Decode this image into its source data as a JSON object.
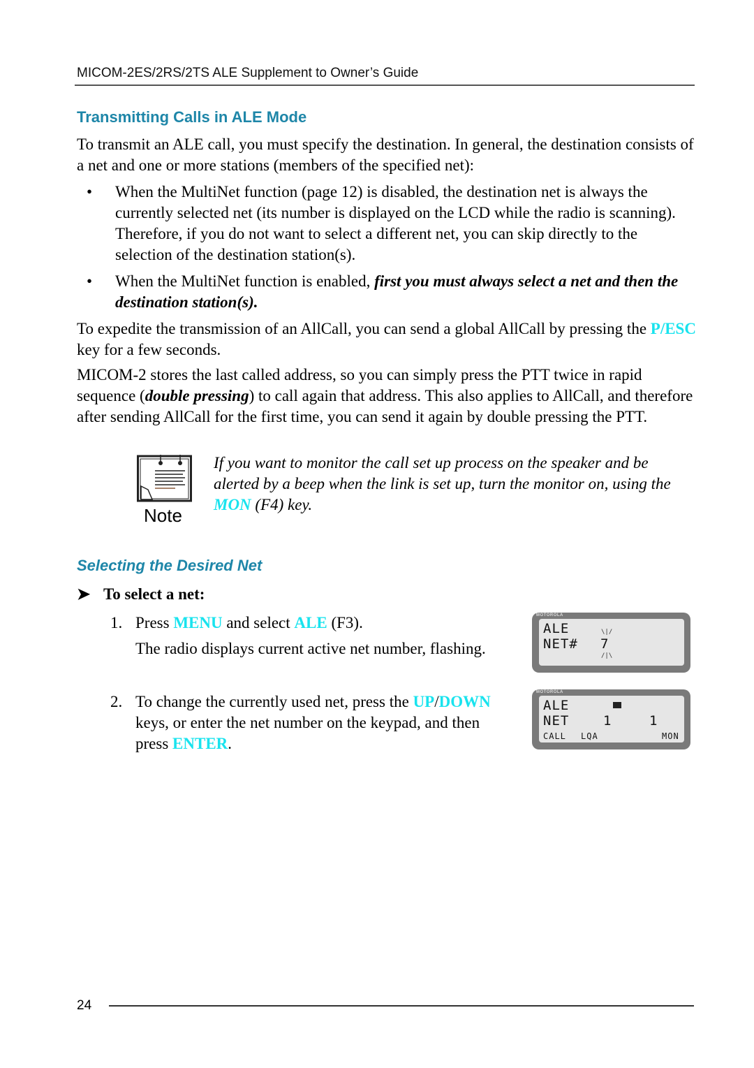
{
  "header": {
    "title": "MICOM-2ES/2RS/2TS ALE Supplement to Owner’s Guide"
  },
  "section1": {
    "heading": "Transmitting Calls in ALE Mode",
    "intro": "To transmit an ALE call, you must specify the destination. In general, the destination consists of a net and one or more stations (members of the specified net):",
    "bullets": [
      {
        "symbol": "•",
        "text": "When the MultiNet function (page 12) is disabled, the destination net is always the currently selected net (its number is displayed on the LCD while the radio is scanning). Therefore, if you do not want to select a different net, you can skip directly to the selection of the destination station(s)."
      },
      {
        "symbol": "•",
        "text_before": "When the MultiNet function is enabled, ",
        "text_emphasis": "first you must always select a net and then the destination station(s)."
      }
    ],
    "para_allcall": {
      "before": "To expedite the transmission of an AllCall, you can send a global AllCall by pressing the ",
      "key": "P/ESC",
      "after": " key for a few seconds."
    },
    "para_double": {
      "before": "MICOM-2 stores the last called address, so you can simply press the PTT twice in rapid sequence (",
      "emphasis": "double pressing",
      "after": ") to call again that address. This also applies to AllCall, and therefore after sending AllCall for the first time, you can send it again by double pressing the PTT."
    }
  },
  "note": {
    "label": "Note",
    "before": "If you want to monitor the call set up process on the speaker and be alerted by a beep when the link is set up, turn the monitor on, using the ",
    "key": "MON",
    "after": " (F4) key."
  },
  "section2": {
    "heading": "Selecting the Desired Net",
    "procedure_arrow": "➤",
    "procedure_title": "To select a net:",
    "steps": [
      {
        "num": "1.",
        "before": "Press ",
        "key1": "MENU",
        "mid": " and select ",
        "key2": "ALE",
        "after": " (F3).",
        "detail": "The radio displays current active net number, flashing."
      },
      {
        "num": "2.",
        "before": "To change the currently used net, press the ",
        "key1": "UP",
        "slash": "/",
        "key2": "DOWN",
        "mid": " keys, or enter the net number on the keypad, and then press ",
        "key3": "ENTER",
        "after": "."
      }
    ]
  },
  "lcd1": {
    "brand": "MOTOROLA",
    "line1": "ALE",
    "line2_label": "NET#",
    "line2_value": "7",
    "blink_top": "\\|/",
    "blink_bottom": "/|\\"
  },
  "lcd2": {
    "brand": "MOTOROLA",
    "line1": "ALE",
    "line2_label": "NET",
    "value_a": "1",
    "value_b": "1",
    "soft_keys": [
      "CALL",
      "LQA",
      "MON"
    ]
  },
  "colors": {
    "heading": "#1e86a8",
    "key": "#19e3ee"
  },
  "footer": {
    "page_number": "24"
  }
}
